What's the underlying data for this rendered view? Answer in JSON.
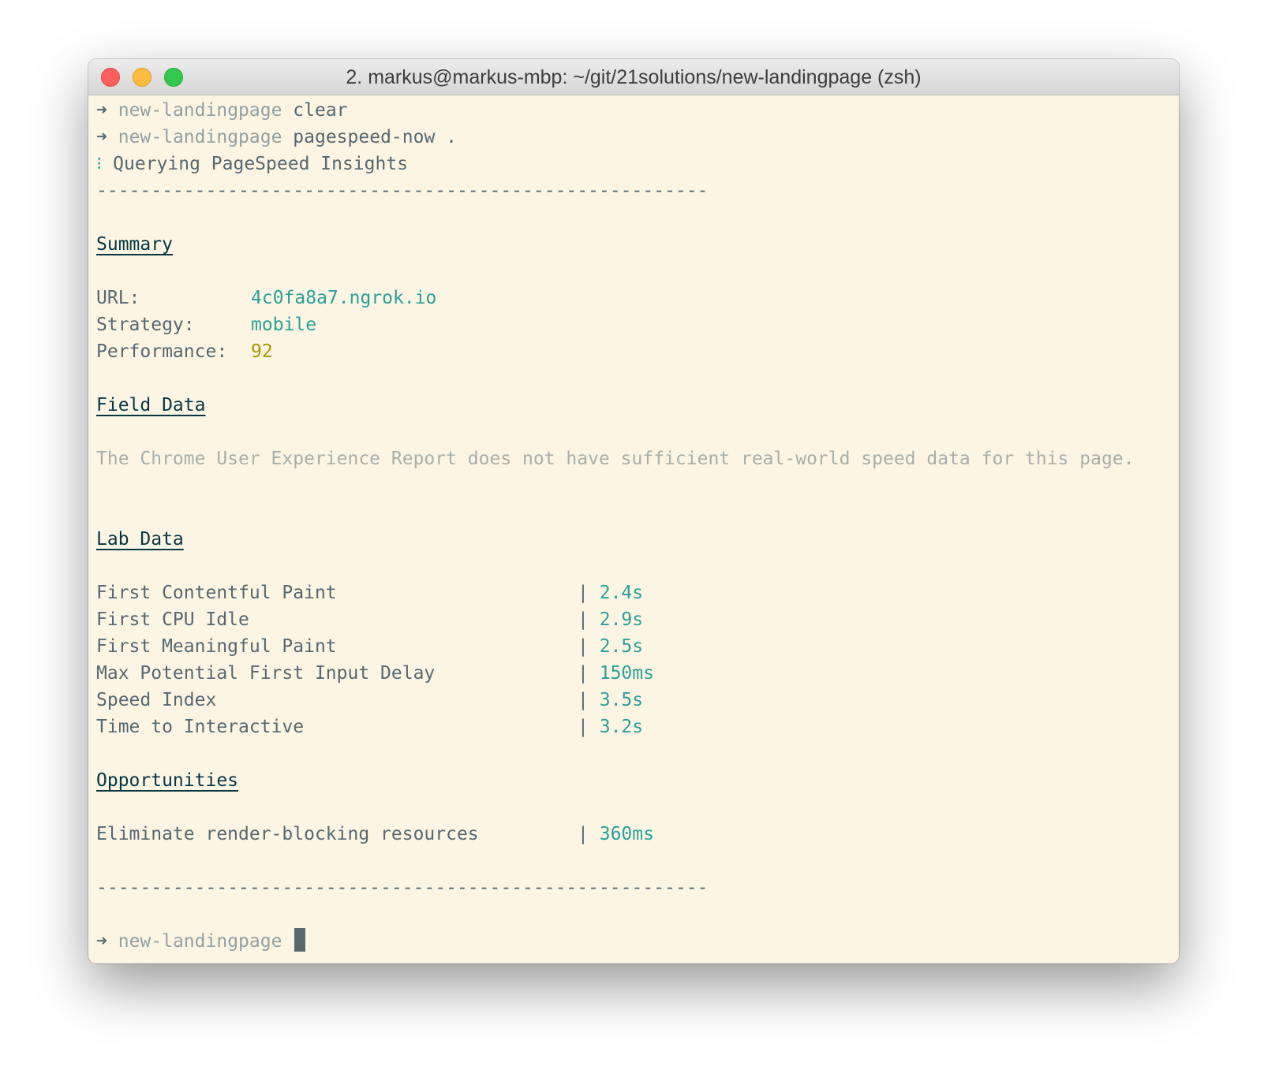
{
  "window": {
    "title": "2. markus@markus-mbp: ~/git/21solutions/new-landingpage (zsh)"
  },
  "prompt": {
    "arrow": "➜",
    "dir": "new-landingpage"
  },
  "commands": [
    {
      "cmd": "clear"
    },
    {
      "cmd": "pagespeed-now ."
    }
  ],
  "status": {
    "spinner": "⁝",
    "text": "Querying PageSpeed Insights"
  },
  "separator": "--------------------------------------------------------",
  "summary": {
    "heading": "Summary",
    "url_label": "URL:",
    "url_value": "4c0fa8a7.ngrok.io",
    "strategy_label": "Strategy:",
    "strategy_value": "mobile",
    "performance_label": "Performance:",
    "performance_value": "92"
  },
  "field_data": {
    "heading": "Field Data",
    "message": "The Chrome User Experience Report does not have sufficient real-world speed data for this page."
  },
  "lab_data": {
    "heading": "Lab Data",
    "divider": "|",
    "metrics": [
      {
        "name": "First Contentful Paint",
        "value": "2.4s"
      },
      {
        "name": "First CPU Idle",
        "value": "2.9s"
      },
      {
        "name": "First Meaningful Paint",
        "value": "2.5s"
      },
      {
        "name": "Max Potential First Input Delay",
        "value": "150ms"
      },
      {
        "name": "Speed Index",
        "value": "3.5s"
      },
      {
        "name": "Time to Interactive",
        "value": "3.2s"
      }
    ]
  },
  "opportunities": {
    "heading": "Opportunities",
    "items": [
      {
        "name": "Eliminate render-blocking resources",
        "value": "360ms"
      }
    ]
  },
  "colors": {
    "background": "#fcf5e4",
    "text": "#58686e",
    "accent_teal": "#2aa198",
    "accent_olive": "#a39a00",
    "muted": "#a9aea9"
  }
}
